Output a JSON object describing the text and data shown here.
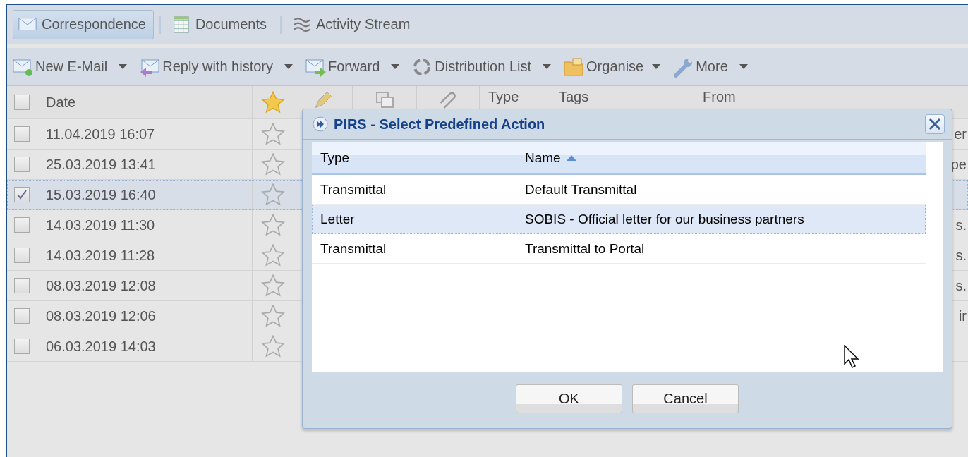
{
  "tabs": [
    {
      "label": "Correspondence",
      "selected": true
    },
    {
      "label": "Documents",
      "selected": false
    },
    {
      "label": "Activity Stream",
      "selected": false
    }
  ],
  "toolbar": [
    {
      "label": "New E-Mail"
    },
    {
      "label": "Reply with history"
    },
    {
      "label": "Forward"
    },
    {
      "label": "Distribution List"
    },
    {
      "label": "Organise"
    },
    {
      "label": "More"
    }
  ],
  "grid": {
    "columns": [
      "Date",
      "Type",
      "Tags",
      "From"
    ],
    "all_checked": false,
    "rows": [
      {
        "date": "11.04.2019 16:07",
        "checked": false,
        "selected": false,
        "from": "er"
      },
      {
        "date": "25.03.2019 13:41",
        "checked": false,
        "selected": false,
        "from": "pe"
      },
      {
        "date": "15.03.2019 16:40",
        "checked": true,
        "selected": true,
        "from": ""
      },
      {
        "date": "14.03.2019 11:30",
        "checked": false,
        "selected": false,
        "from": "s."
      },
      {
        "date": "14.03.2019 11:28",
        "checked": false,
        "selected": false,
        "from": "s."
      },
      {
        "date": "08.03.2019 12:08",
        "checked": false,
        "selected": false,
        "from": "s."
      },
      {
        "date": "08.03.2019 12:06",
        "checked": false,
        "selected": false,
        "from": "ir"
      },
      {
        "date": "06.03.2019 14:03",
        "checked": false,
        "selected": false,
        "from": ""
      }
    ]
  },
  "dialog": {
    "title": "PIRS - Select Predefined Action",
    "columns": [
      {
        "label": "Type",
        "sorted": false
      },
      {
        "label": "Name",
        "sorted": true
      }
    ],
    "rows": [
      {
        "type": "Transmittal",
        "name": "Default Transmittal",
        "selected": false
      },
      {
        "type": "Letter",
        "name": "SOBIS - Official letter for our business partners",
        "selected": true
      },
      {
        "type": "Transmittal",
        "name": "Transmittal to Portal",
        "selected": false
      }
    ],
    "buttons": [
      "OK",
      "Cancel"
    ]
  }
}
